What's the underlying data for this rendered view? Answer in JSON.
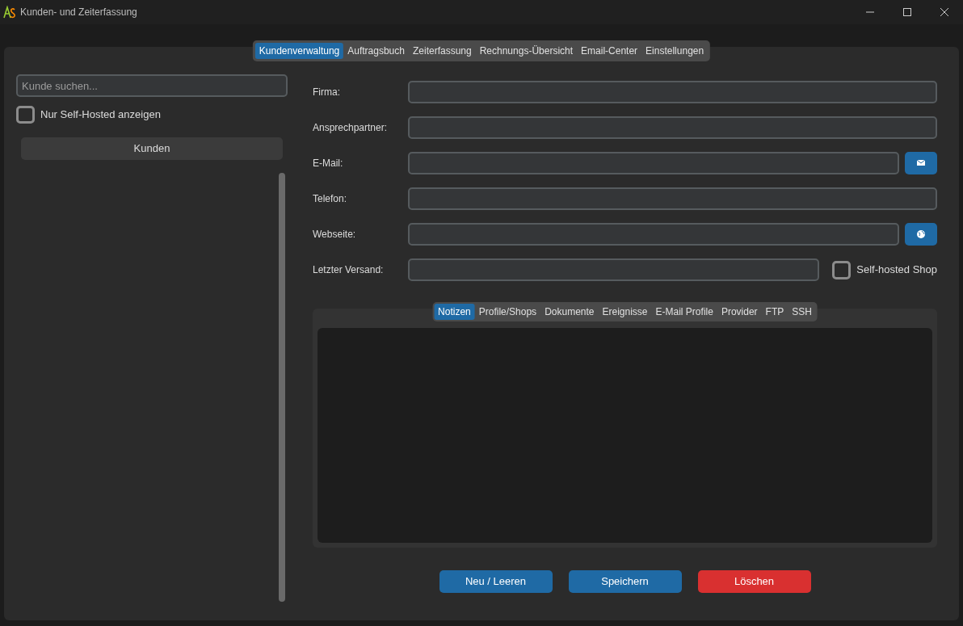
{
  "window": {
    "title": "Kunden- und Zeiterfassung"
  },
  "tabs": [
    {
      "label": "Kundenverwaltung",
      "selected": true
    },
    {
      "label": "Auftragsbuch",
      "selected": false
    },
    {
      "label": "Zeiterfassung",
      "selected": false
    },
    {
      "label": "Rechnungs-Übersicht",
      "selected": false
    },
    {
      "label": "Email-Center",
      "selected": false
    },
    {
      "label": "Einstellungen",
      "selected": false
    }
  ],
  "sidebar": {
    "search": {
      "placeholder": "Kunde suchen..."
    },
    "filter": {
      "label": "Nur Self-Hosted anzeigen",
      "checked": false
    },
    "header": "Kunden"
  },
  "fields": [
    {
      "label": "Firma:",
      "kind": "plain"
    },
    {
      "label": "Ansprechpartner:",
      "kind": "plain"
    },
    {
      "label": "E-Mail:",
      "kind": "mail"
    },
    {
      "label": "Telefon:",
      "kind": "plain"
    },
    {
      "label": "Webseite:",
      "kind": "web"
    },
    {
      "label": "Letzter Versand:",
      "kind": "check",
      "check_label": "Self-hosted Shop",
      "checked": false
    }
  ],
  "subtabs": [
    {
      "label": "Notizen",
      "selected": true
    },
    {
      "label": "Profile/Shops",
      "selected": false
    },
    {
      "label": "Dokumente",
      "selected": false
    },
    {
      "label": "Ereignisse",
      "selected": false
    },
    {
      "label": "E-Mail Profile",
      "selected": false
    },
    {
      "label": "Provider",
      "selected": false
    },
    {
      "label": "FTP",
      "selected": false
    },
    {
      "label": "SSH",
      "selected": false
    }
  ],
  "buttons": [
    {
      "label": "Neu / Leeren",
      "kind": "primary"
    },
    {
      "label": "Speichern",
      "kind": "primary"
    },
    {
      "label": "Löschen",
      "kind": "danger"
    }
  ]
}
